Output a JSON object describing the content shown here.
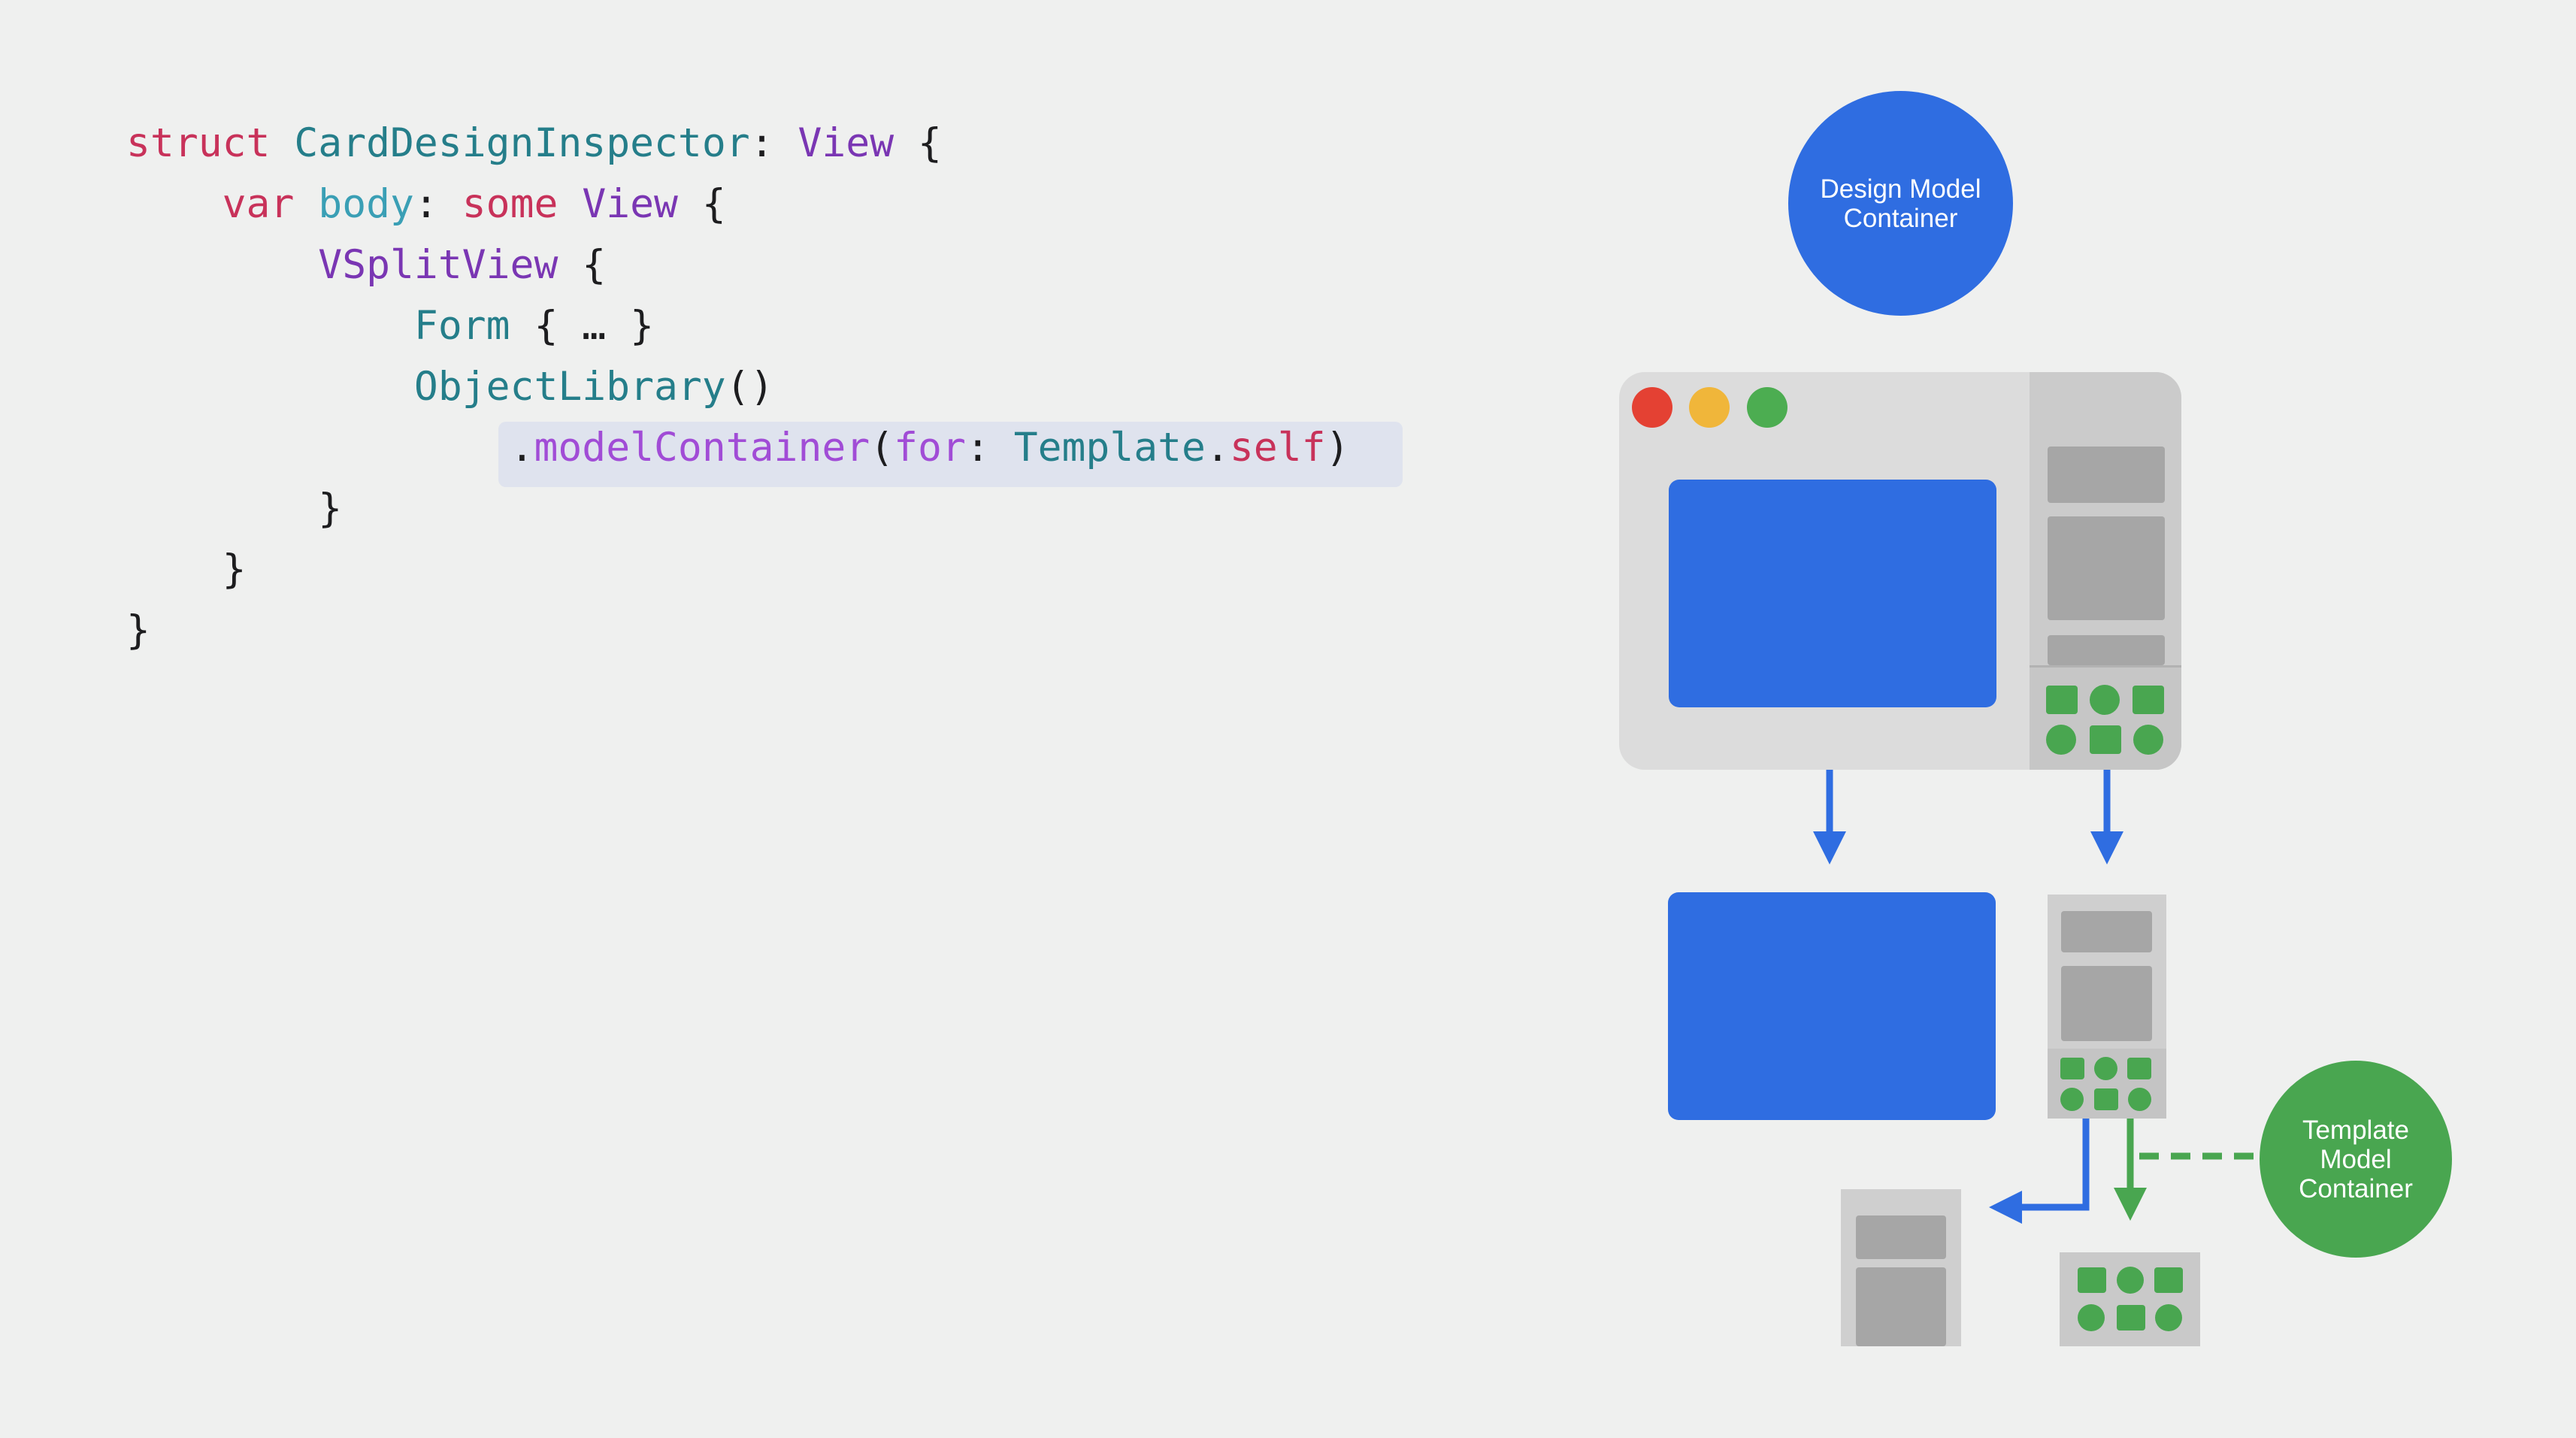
{
  "code": {
    "lines": [
      [
        {
          "t": "struct",
          "c": "k"
        },
        {
          "t": " ",
          "c": "pl"
        },
        {
          "t": "CardDesignInspector",
          "c": "t"
        },
        {
          "t": ": ",
          "c": "pl"
        },
        {
          "t": "View",
          "c": "p"
        },
        {
          "t": " {",
          "c": "pl"
        }
      ],
      [
        {
          "t": "    ",
          "c": "pl"
        },
        {
          "t": "var",
          "c": "k"
        },
        {
          "t": " ",
          "c": "pl"
        },
        {
          "t": "body",
          "c": "v"
        },
        {
          "t": ": ",
          "c": "pl"
        },
        {
          "t": "some",
          "c": "k"
        },
        {
          "t": " ",
          "c": "pl"
        },
        {
          "t": "View",
          "c": "p"
        },
        {
          "t": " {",
          "c": "pl"
        }
      ],
      [
        {
          "t": "        ",
          "c": "pl"
        },
        {
          "t": "VSplitView",
          "c": "p"
        },
        {
          "t": " {",
          "c": "pl"
        }
      ],
      [
        {
          "t": "            ",
          "c": "pl"
        },
        {
          "t": "Form",
          "c": "t"
        },
        {
          "t": " { … }",
          "c": "pl"
        }
      ],
      [
        {
          "t": "            ",
          "c": "pl"
        },
        {
          "t": "ObjectLibrary",
          "c": "t"
        },
        {
          "t": "()",
          "c": "pl"
        }
      ],
      [
        {
          "t": "                ",
          "c": "pl"
        },
        {
          "t": ".",
          "c": "pl"
        },
        {
          "t": "modelContainer",
          "c": "m"
        },
        {
          "t": "(",
          "c": "pl"
        },
        {
          "t": "for",
          "c": "m"
        },
        {
          "t": ": ",
          "c": "pl"
        },
        {
          "t": "Template",
          "c": "t"
        },
        {
          "t": ".",
          "c": "pl"
        },
        {
          "t": "self",
          "c": "k"
        },
        {
          "t": ")",
          "c": "pl"
        }
      ],
      [
        {
          "t": "        }",
          "c": "pl"
        }
      ],
      [
        {
          "t": "    }",
          "c": "pl"
        }
      ],
      [
        {
          "t": "}",
          "c": "pl"
        }
      ]
    ],
    "highlighted_line": 5
  },
  "diagram": {
    "design_container_label": "Design Model\nContainer",
    "template_container_label": "Template\nModel\nContainer",
    "colors": {
      "blue": "#2f6de1",
      "green": "#49a650",
      "window_red": "#e44133",
      "window_yellow": "#f0b63a",
      "window_green": "#4cad51"
    }
  }
}
